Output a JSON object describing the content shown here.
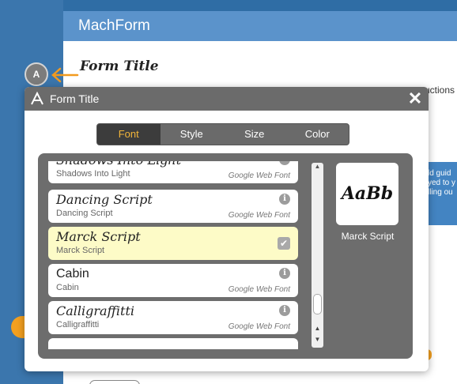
{
  "app": {
    "title": "MachForm"
  },
  "background": {
    "instructions_text": "uctions",
    "blue_box_text": [
      "ld guid",
      "yed to y",
      "lling ou"
    ]
  },
  "callout": {
    "badge": "A",
    "label": "Form Title"
  },
  "dialog": {
    "title": "Form Title",
    "close_label": "✕",
    "tabs": [
      {
        "label": "Font",
        "active": true
      },
      {
        "label": "Style",
        "active": false
      },
      {
        "label": "Size",
        "active": false
      },
      {
        "label": "Color",
        "active": false
      }
    ],
    "fonts": [
      {
        "name": "Shadows Into Light",
        "sub": "Shadows Into Light",
        "source": "Google Web Font",
        "selected": false
      },
      {
        "name": "Dancing Script",
        "sub": "Dancing Script",
        "source": "Google Web Font",
        "selected": false
      },
      {
        "name": "Marck Script",
        "sub": "Marck Script",
        "source": "",
        "selected": true
      },
      {
        "name": "Cabin",
        "sub": "Cabin",
        "source": "Google Web Font",
        "selected": false
      },
      {
        "name": "Calligraffitti",
        "sub": "Calligraffitti",
        "source": "Google Web Font",
        "selected": false
      },
      {
        "name": "",
        "sub": "",
        "source": "",
        "selected": false
      }
    ],
    "preview": {
      "sample": "AaBb",
      "font_name": "Marck Script"
    },
    "icons": {
      "info": "info-icon",
      "check": "check-icon",
      "close": "close-icon"
    }
  }
}
